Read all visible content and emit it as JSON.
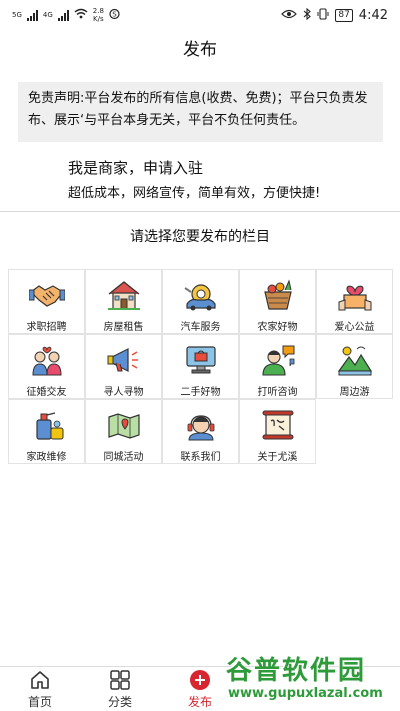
{
  "status": {
    "network": "5G",
    "network2": "4G",
    "speed_value": "2.8",
    "speed_unit": "K/s",
    "battery": "87",
    "time": "4:42"
  },
  "header": {
    "title": "发布"
  },
  "disclaimer": {
    "text": "免责声明:平台发布的所有信息(收费、免费)；平台只负责发布、展示‘与平台本身无关，平台不负任何责任。"
  },
  "merchant": {
    "title": "我是商家，申请入驻",
    "subtitle": "超低成本，网络宣传，简单有效，方便快捷!"
  },
  "section": {
    "title": "请选择您要发布的栏目"
  },
  "categories": [
    {
      "label": "求职招聘",
      "icon": "handshake-icon"
    },
    {
      "label": "房屋租售",
      "icon": "house-icon"
    },
    {
      "label": "汽车服务",
      "icon": "car-service-icon"
    },
    {
      "label": "农家好物",
      "icon": "farm-basket-icon"
    },
    {
      "label": "爱心公益",
      "icon": "charity-heart-icon"
    },
    {
      "label": "征婚交友",
      "icon": "couple-icon"
    },
    {
      "label": "寻人寻物",
      "icon": "megaphone-icon"
    },
    {
      "label": "二手好物",
      "icon": "secondhand-icon"
    },
    {
      "label": "打听咨询",
      "icon": "consult-icon"
    },
    {
      "label": "周边游",
      "icon": "travel-icon"
    },
    {
      "label": "家政维修",
      "icon": "cleaning-icon"
    },
    {
      "label": "同城活动",
      "icon": "map-icon"
    },
    {
      "label": "联系我们",
      "icon": "contact-icon"
    },
    {
      "label": "关于尤溪",
      "icon": "scroll-icon"
    }
  ],
  "nav": {
    "home": "首页",
    "category": "分类",
    "publish": "发布"
  },
  "watermark": {
    "line1": "谷普软件园",
    "line2": "www.gupuxlazal.com"
  },
  "colors": {
    "accent": "#d6262f",
    "disclaimer_bg": "#efefef",
    "watermark": "#2e9a3a"
  }
}
